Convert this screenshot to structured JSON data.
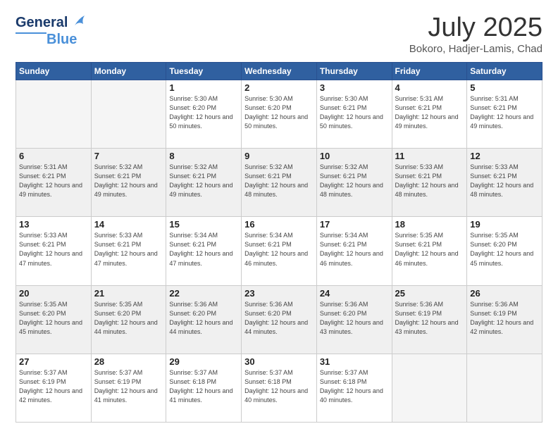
{
  "header": {
    "logo_line1": "General",
    "logo_line2": "Blue",
    "title": "July 2025",
    "location": "Bokoro, Hadjer-Lamis, Chad"
  },
  "days_of_week": [
    "Sunday",
    "Monday",
    "Tuesday",
    "Wednesday",
    "Thursday",
    "Friday",
    "Saturday"
  ],
  "weeks": [
    [
      {
        "day": "",
        "empty": true
      },
      {
        "day": "",
        "empty": true
      },
      {
        "day": "1",
        "sunrise": "5:30 AM",
        "sunset": "6:20 PM",
        "daylight": "12 hours and 50 minutes."
      },
      {
        "day": "2",
        "sunrise": "5:30 AM",
        "sunset": "6:20 PM",
        "daylight": "12 hours and 50 minutes."
      },
      {
        "day": "3",
        "sunrise": "5:30 AM",
        "sunset": "6:21 PM",
        "daylight": "12 hours and 50 minutes."
      },
      {
        "day": "4",
        "sunrise": "5:31 AM",
        "sunset": "6:21 PM",
        "daylight": "12 hours and 49 minutes."
      },
      {
        "day": "5",
        "sunrise": "5:31 AM",
        "sunset": "6:21 PM",
        "daylight": "12 hours and 49 minutes."
      }
    ],
    [
      {
        "day": "6",
        "sunrise": "5:31 AM",
        "sunset": "6:21 PM",
        "daylight": "12 hours and 49 minutes."
      },
      {
        "day": "7",
        "sunrise": "5:32 AM",
        "sunset": "6:21 PM",
        "daylight": "12 hours and 49 minutes."
      },
      {
        "day": "8",
        "sunrise": "5:32 AM",
        "sunset": "6:21 PM",
        "daylight": "12 hours and 49 minutes."
      },
      {
        "day": "9",
        "sunrise": "5:32 AM",
        "sunset": "6:21 PM",
        "daylight": "12 hours and 48 minutes."
      },
      {
        "day": "10",
        "sunrise": "5:32 AM",
        "sunset": "6:21 PM",
        "daylight": "12 hours and 48 minutes."
      },
      {
        "day": "11",
        "sunrise": "5:33 AM",
        "sunset": "6:21 PM",
        "daylight": "12 hours and 48 minutes."
      },
      {
        "day": "12",
        "sunrise": "5:33 AM",
        "sunset": "6:21 PM",
        "daylight": "12 hours and 48 minutes."
      }
    ],
    [
      {
        "day": "13",
        "sunrise": "5:33 AM",
        "sunset": "6:21 PM",
        "daylight": "12 hours and 47 minutes."
      },
      {
        "day": "14",
        "sunrise": "5:33 AM",
        "sunset": "6:21 PM",
        "daylight": "12 hours and 47 minutes."
      },
      {
        "day": "15",
        "sunrise": "5:34 AM",
        "sunset": "6:21 PM",
        "daylight": "12 hours and 47 minutes."
      },
      {
        "day": "16",
        "sunrise": "5:34 AM",
        "sunset": "6:21 PM",
        "daylight": "12 hours and 46 minutes."
      },
      {
        "day": "17",
        "sunrise": "5:34 AM",
        "sunset": "6:21 PM",
        "daylight": "12 hours and 46 minutes."
      },
      {
        "day": "18",
        "sunrise": "5:35 AM",
        "sunset": "6:21 PM",
        "daylight": "12 hours and 46 minutes."
      },
      {
        "day": "19",
        "sunrise": "5:35 AM",
        "sunset": "6:20 PM",
        "daylight": "12 hours and 45 minutes."
      }
    ],
    [
      {
        "day": "20",
        "sunrise": "5:35 AM",
        "sunset": "6:20 PM",
        "daylight": "12 hours and 45 minutes."
      },
      {
        "day": "21",
        "sunrise": "5:35 AM",
        "sunset": "6:20 PM",
        "daylight": "12 hours and 44 minutes."
      },
      {
        "day": "22",
        "sunrise": "5:36 AM",
        "sunset": "6:20 PM",
        "daylight": "12 hours and 44 minutes."
      },
      {
        "day": "23",
        "sunrise": "5:36 AM",
        "sunset": "6:20 PM",
        "daylight": "12 hours and 44 minutes."
      },
      {
        "day": "24",
        "sunrise": "5:36 AM",
        "sunset": "6:20 PM",
        "daylight": "12 hours and 43 minutes."
      },
      {
        "day": "25",
        "sunrise": "5:36 AM",
        "sunset": "6:19 PM",
        "daylight": "12 hours and 43 minutes."
      },
      {
        "day": "26",
        "sunrise": "5:36 AM",
        "sunset": "6:19 PM",
        "daylight": "12 hours and 42 minutes."
      }
    ],
    [
      {
        "day": "27",
        "sunrise": "5:37 AM",
        "sunset": "6:19 PM",
        "daylight": "12 hours and 42 minutes."
      },
      {
        "day": "28",
        "sunrise": "5:37 AM",
        "sunset": "6:19 PM",
        "daylight": "12 hours and 41 minutes."
      },
      {
        "day": "29",
        "sunrise": "5:37 AM",
        "sunset": "6:18 PM",
        "daylight": "12 hours and 41 minutes."
      },
      {
        "day": "30",
        "sunrise": "5:37 AM",
        "sunset": "6:18 PM",
        "daylight": "12 hours and 40 minutes."
      },
      {
        "day": "31",
        "sunrise": "5:37 AM",
        "sunset": "6:18 PM",
        "daylight": "12 hours and 40 minutes."
      },
      {
        "day": "",
        "empty": true
      },
      {
        "day": "",
        "empty": true
      }
    ]
  ],
  "labels": {
    "sunrise": "Sunrise:",
    "sunset": "Sunset:",
    "daylight": "Daylight:"
  }
}
